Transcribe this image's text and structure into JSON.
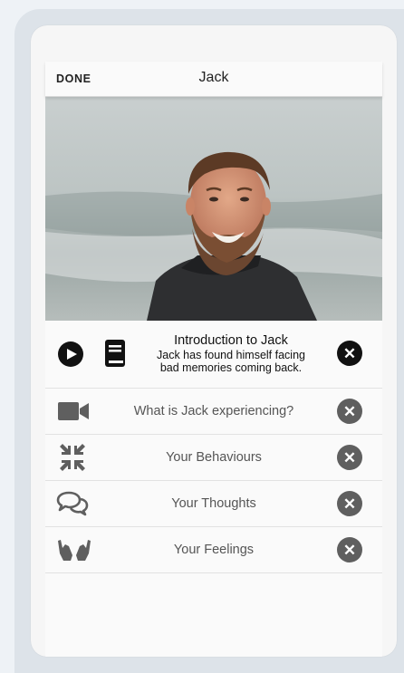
{
  "header": {
    "done_label": "DONE",
    "title": "Jack"
  },
  "intro": {
    "title": "Introduction to Jack",
    "description_line1": "Jack has found himself facing",
    "description_line2": "bad memories coming back."
  },
  "items": [
    {
      "label": "What is Jack experiencing?",
      "icon": "video-camera-icon"
    },
    {
      "label": "Your Behaviours",
      "icon": "compress-arrows-icon"
    },
    {
      "label": "Your Thoughts",
      "icon": "speech-bubbles-icon"
    },
    {
      "label": "Your Feelings",
      "icon": "hands-icon"
    }
  ],
  "colors": {
    "background": "#eef2f6",
    "frame": "#dde3e9",
    "icon_grey": "#5f5f5f",
    "icon_dark": "#111111"
  }
}
